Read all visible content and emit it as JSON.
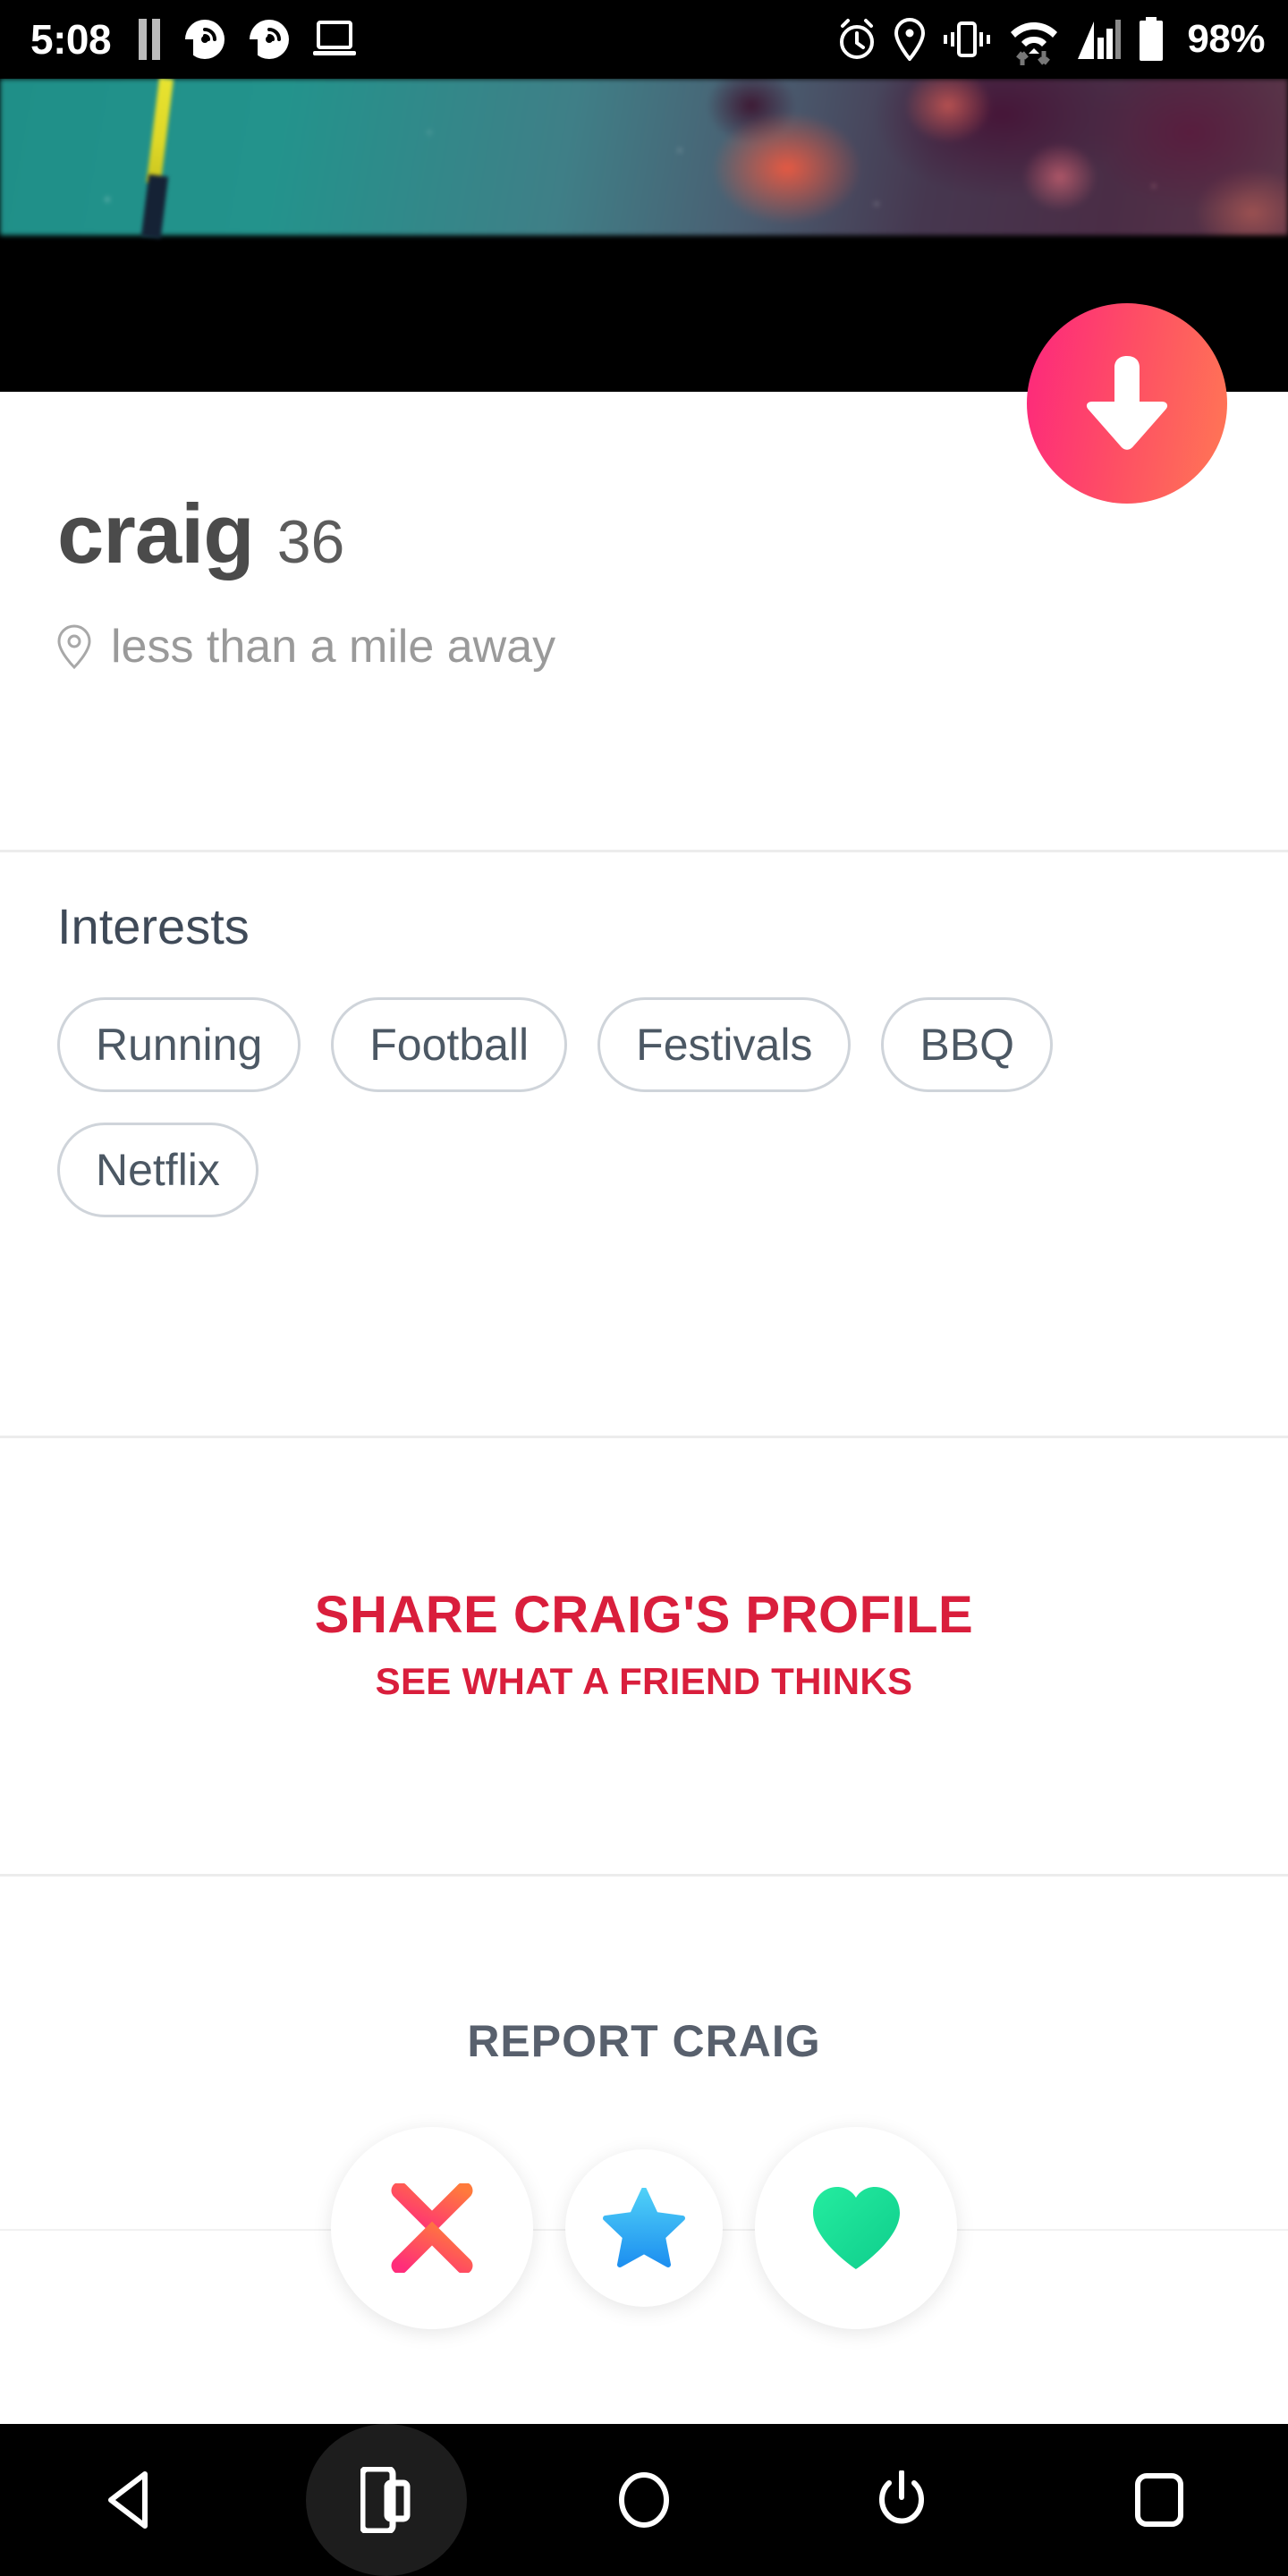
{
  "status_bar": {
    "time": "5:08",
    "battery_percent": "98%",
    "left_icons": [
      "pause-icon",
      "cast-audio-icon",
      "cast-audio-icon",
      "laptop-icon"
    ],
    "right_icons": [
      "alarm-icon",
      "location-icon",
      "vibrate-icon",
      "wifi-icon",
      "signal-icon",
      "battery-icon"
    ]
  },
  "hero": {
    "scroll_down_icon": "arrow-down-icon",
    "fab_gradient_start": "#fd267d",
    "fab_gradient_end": "#ff7854"
  },
  "profile": {
    "name": "craig",
    "age": "36",
    "distance": "less than a mile away",
    "location_icon": "map-pin-icon"
  },
  "interests": {
    "title": "Interests",
    "chips": [
      "Running",
      "Football",
      "Festivals",
      "BBQ",
      "Netflix"
    ]
  },
  "share": {
    "main_label": "SHARE CRAIG'S PROFILE",
    "sub_label": "SEE WHAT A FRIEND THINKS",
    "color": "#d91e3c"
  },
  "report": {
    "label": "REPORT CRAIG",
    "color": "#58606d"
  },
  "actions": [
    {
      "name": "nope-button",
      "icon": "cross-icon",
      "color_start": "#ff5e62",
      "color_end": "#ff2d7a"
    },
    {
      "name": "superlike-button",
      "icon": "star-icon",
      "color_start": "#4fc3f7",
      "color_end": "#1e9bf0"
    },
    {
      "name": "like-button",
      "icon": "heart-icon",
      "color_start": "#21e6a0",
      "color_end": "#12d18e"
    }
  ],
  "navbar": {
    "buttons": [
      {
        "name": "back-button",
        "icon": "back-triangle-icon"
      },
      {
        "name": "screenshot-button",
        "icon": "phone-screenshot-icon",
        "active": true
      },
      {
        "name": "home-button",
        "icon": "home-circle-icon"
      },
      {
        "name": "power-button",
        "icon": "power-icon"
      },
      {
        "name": "recents-button",
        "icon": "square-icon"
      }
    ]
  }
}
